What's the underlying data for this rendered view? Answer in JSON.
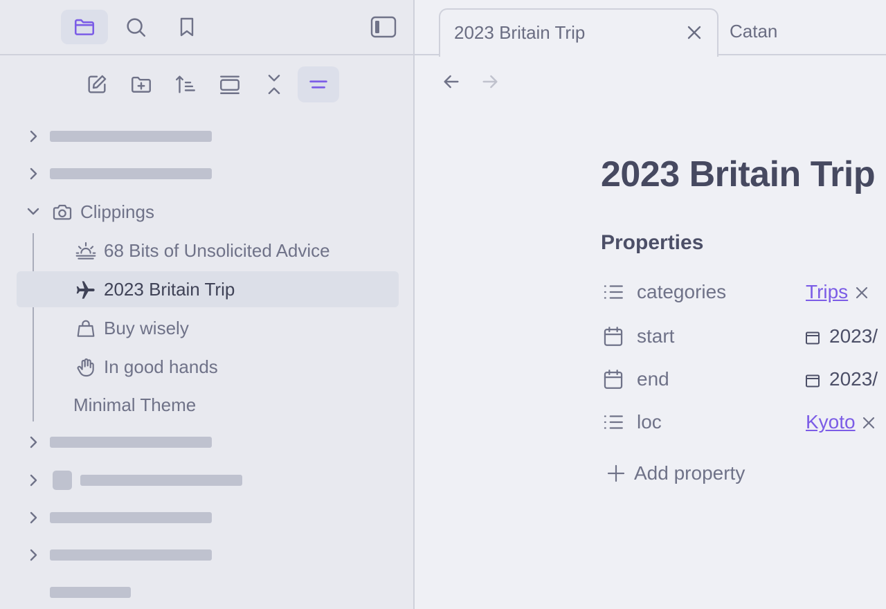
{
  "colors": {
    "accent": "#7b5ce6",
    "sidebar_bg": "#e8e9ef",
    "main_bg": "#eff0f5"
  },
  "sidebar": {
    "top_icons": [
      "folder-icon",
      "search-icon",
      "bookmark-icon",
      "sidebar-toggle-icon"
    ],
    "toolbar_icons": [
      "new-note-icon",
      "new-folder-icon",
      "sort-icon",
      "collapse-all-icon",
      "expand-collapse-icon",
      "menu-lines-icon"
    ],
    "folder": {
      "label": "Clippings",
      "icon": "camera-icon"
    },
    "files": [
      {
        "label": "68 Bits of Unsolicited Advice",
        "icon": "sunrise-icon"
      },
      {
        "label": "2023 Britain Trip",
        "icon": "plane-icon"
      },
      {
        "label": "Buy wisely",
        "icon": "shopping-bag-icon"
      },
      {
        "label": "In good hands",
        "icon": "hand-icon"
      },
      {
        "label": "Minimal Theme",
        "icon": ""
      }
    ]
  },
  "tabs": [
    {
      "title": "2023 Britain Trip"
    },
    {
      "title": "Catan"
    }
  ],
  "note": {
    "title": "2023 Britain Trip",
    "properties_heading": "Properties",
    "properties": [
      {
        "key": "categories",
        "value": "Trips",
        "icon": "list-icon"
      },
      {
        "key": "start",
        "value": "2023/",
        "icon": "calendar-icon"
      },
      {
        "key": "end",
        "value": "2023/",
        "icon": "calendar-icon"
      },
      {
        "key": "loc",
        "value": "Kyoto",
        "icon": "list-icon"
      }
    ],
    "add_property_label": "Add property"
  }
}
